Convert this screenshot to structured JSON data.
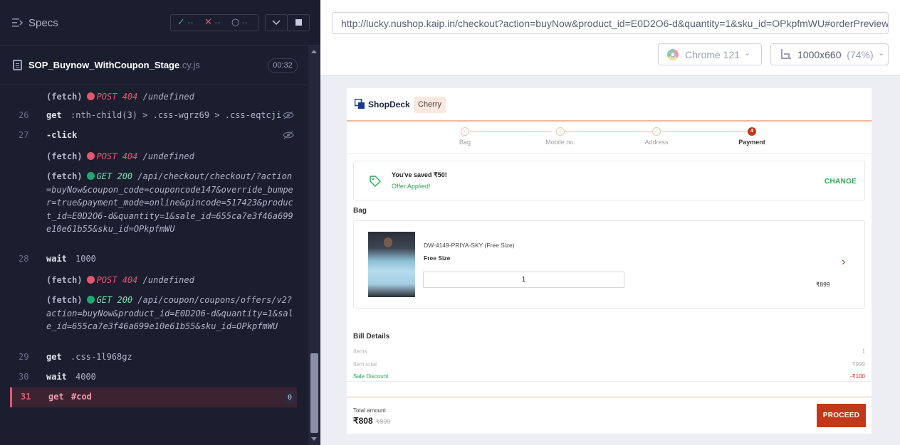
{
  "runner": {
    "title": "Specs",
    "stats": {
      "passed": "--",
      "failed": "--",
      "pending": "--",
      "pass_glyph": "✓",
      "fail_glyph": "✕",
      "pend_glyph": "○"
    },
    "spec_file": {
      "name": "SOP_Buynow_WithCoupon_Stage",
      "ext": ".cy.js",
      "duration": "00:32"
    },
    "commands": [
      {
        "type": "xhr",
        "paren": "(fetch)",
        "status": "fail",
        "method": "POST 404",
        "url": "/undefined"
      },
      {
        "type": "cmd",
        "num": "26",
        "name": "get",
        "arg": ":nth-child(3) > .css-wgrz69 > .css-eqtcji",
        "hidden": true
      },
      {
        "type": "cmd",
        "num": "27",
        "name": "-click",
        "arg": "",
        "hidden": true
      },
      {
        "type": "xhr",
        "paren": "(fetch)",
        "status": "fail",
        "method": "POST 404",
        "url": "/undefined"
      },
      {
        "type": "xhr",
        "paren": "(fetch)",
        "status": "ok",
        "method": "GET 200",
        "url": "/api/checkout/checkout/?action=buyNow&coupon_code=couponcode147&override_bumper=true&payment_mode=online&pincode=517423&product_id=E0D2O6-d&quantity=1&sale_id=655ca7e3f46a699e10e61b55&sku_id=OPkpfmWU"
      },
      {
        "type": "cmd",
        "num": "28",
        "name": "wait",
        "arg": "1000"
      },
      {
        "type": "xhr",
        "paren": "(fetch)",
        "status": "fail",
        "method": "POST 404",
        "url": "/undefined"
      },
      {
        "type": "xhr",
        "paren": "(fetch)",
        "status": "ok",
        "method": "GET 200",
        "url": "/api/coupon/coupons/offers/v2?action=buyNow&product_id=E0D2O6-d&quantity=1&sale_id=655ca7e3f46a699e10e61b55&sku_id=OPkpfmWU"
      },
      {
        "type": "cmd",
        "num": "29",
        "name": "get",
        "arg": ".css-1l968gz"
      },
      {
        "type": "cmd",
        "num": "30",
        "name": "wait",
        "arg": "4000"
      },
      {
        "type": "cmd",
        "num": "31",
        "name": "get",
        "arg": "#cod",
        "active": true,
        "badge": "0"
      }
    ],
    "colors": {
      "pass": "#1fa971",
      "fail": "#e45770"
    }
  },
  "aut": {
    "url": "http://lucky.nushop.kaip.in/checkout?action=buyNow&product_id=E0D2O6-d&quantity=1&sku_id=OPkpfmWU#orderPreview",
    "browser": "Chrome 121",
    "viewport": "1000x660",
    "zoom": "(74%)"
  },
  "shop": {
    "brand": "ShopDeck",
    "store": "Cherry",
    "accent": "#c1381b",
    "steps": [
      {
        "label": "Bag",
        "state": "done"
      },
      {
        "label": "Mobile no.",
        "state": "done"
      },
      {
        "label": "Address",
        "state": "done"
      },
      {
        "label": "Payment",
        "state": "active",
        "number": "4"
      }
    ],
    "coupon": {
      "saved": "You've saved ₹50!",
      "status": "Offer Applied!",
      "action": "CHANGE"
    },
    "bag": {
      "title": "Bag",
      "product_name": "DW-4149-PRIYA-SKY (Free Size)",
      "size": "Free Size",
      "quantity": "1",
      "price": "₹899"
    },
    "bill": {
      "title": "Bill Details",
      "rows": [
        {
          "label": "Items",
          "value": "1"
        },
        {
          "label": "Item total",
          "value": "₹999"
        },
        {
          "label": "Sale Discount",
          "value": "-₹100"
        }
      ]
    },
    "footer": {
      "total_label": "Total amount",
      "total": "₹808",
      "original": "₹899",
      "cta": "PROCEED"
    }
  }
}
